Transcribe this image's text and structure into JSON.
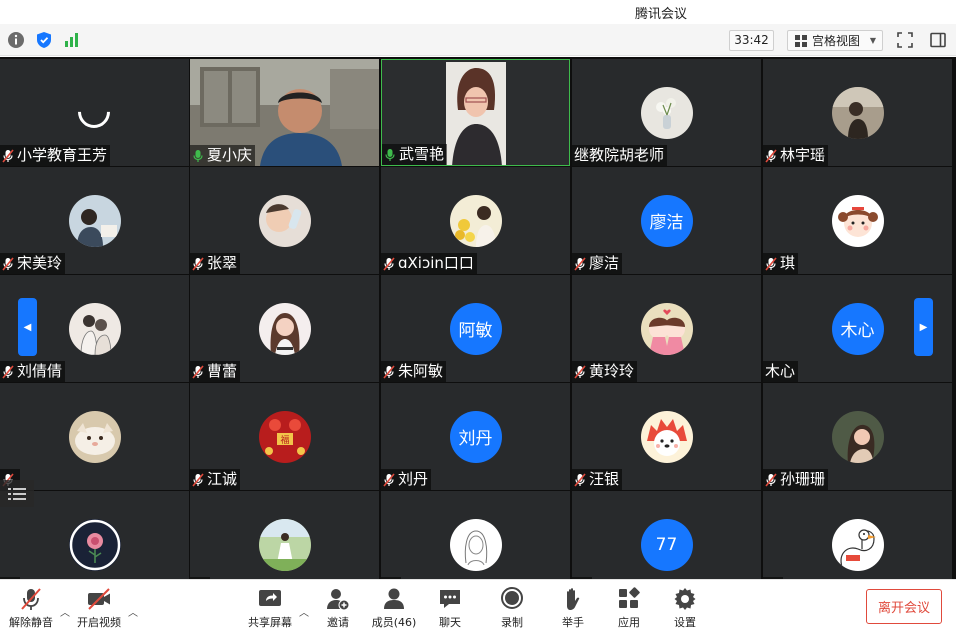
{
  "window": {
    "title": "腾讯会议"
  },
  "toolbar": {
    "timer": "33:42",
    "view_label": "宫格视图",
    "icons": [
      "info-icon",
      "shield-icon",
      "signal-icon",
      "fullscreen-icon",
      "sidebar-toggle-icon"
    ]
  },
  "participants": [
    {
      "name": "小学教育王芳",
      "mic": "muted",
      "avatar": "loading"
    },
    {
      "name": "夏小庆",
      "mic": "active",
      "avatar": "video"
    },
    {
      "name": "武雪艳",
      "mic": "active",
      "avatar": "video",
      "active_speaker": true
    },
    {
      "name": "继教院胡老师",
      "mic": "none",
      "avatar": "photo-vase"
    },
    {
      "name": "林宇瑶",
      "mic": "muted",
      "avatar": "photo-girl"
    },
    {
      "name": "宋美玲",
      "mic": "muted",
      "avatar": "photo-child-drawing"
    },
    {
      "name": "张翠",
      "mic": "muted",
      "avatar": "photo-baby"
    },
    {
      "name": "ɑXiↄin口口",
      "mic": "muted",
      "avatar": "photo-flowers"
    },
    {
      "name": "廖洁",
      "mic": "muted",
      "avatar": "text",
      "avatar_text": "廖洁"
    },
    {
      "name": "琪",
      "mic": "muted",
      "avatar": "cartoon-girl"
    },
    {
      "name": "刘倩倩",
      "mic": "muted",
      "avatar": "sketch-couple"
    },
    {
      "name": "曹蕾",
      "mic": "muted",
      "avatar": "photo-woman"
    },
    {
      "name": "朱阿敏",
      "mic": "muted",
      "avatar": "text",
      "avatar_text": "阿敏"
    },
    {
      "name": "黄玲玲",
      "mic": "muted",
      "avatar": "cartoon-kiss"
    },
    {
      "name": "木心",
      "mic": "none",
      "avatar": "text",
      "avatar_text": "木心"
    },
    {
      "name": "",
      "mic": "muted",
      "avatar": "photo-cat"
    },
    {
      "name": "江诚",
      "mic": "muted",
      "avatar": "red-new-year"
    },
    {
      "name": "刘丹",
      "mic": "muted",
      "avatar": "text",
      "avatar_text": "刘丹"
    },
    {
      "name": "汪银",
      "mic": "muted",
      "avatar": "cartoon-hedgehog"
    },
    {
      "name": "孙珊珊",
      "mic": "muted",
      "avatar": "photo-woman-side"
    },
    {
      "name": "",
      "mic": "muted",
      "avatar": "rose"
    },
    {
      "name": "",
      "mic": "muted",
      "avatar": "photo-girl-field"
    },
    {
      "name": "",
      "mic": "muted",
      "avatar": "sketch-face"
    },
    {
      "name": "",
      "mic": "muted",
      "avatar": "text",
      "avatar_text": "77"
    },
    {
      "name": "",
      "mic": "muted",
      "avatar": "cartoon-goose"
    }
  ],
  "bottombar": {
    "unmute": "解除静音",
    "start_video": "开启视频",
    "share_screen": "共享屏幕",
    "invite": "邀请",
    "members": "成员(46)",
    "chat": "聊天",
    "record": "录制",
    "raise_hand": "举手",
    "apps": "应用",
    "settings": "设置",
    "leave": "离开会议"
  },
  "colors": {
    "accent": "#1677ff",
    "tile_bg": "#282a2c",
    "active_border": "#3fbb4c",
    "leave_red": "#e04a3c"
  }
}
